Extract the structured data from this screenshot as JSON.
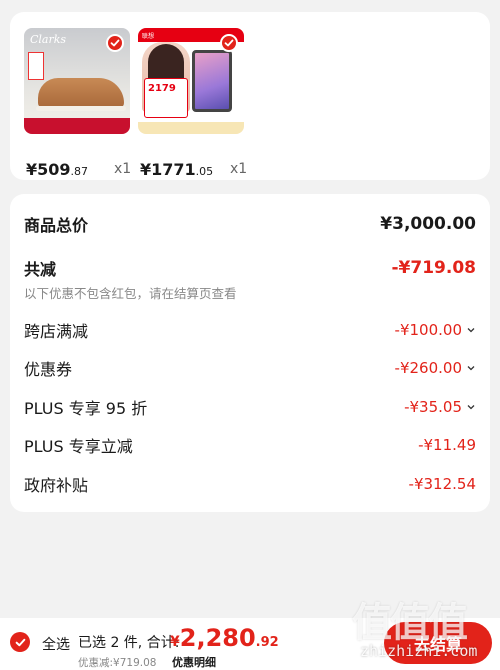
{
  "colors": {
    "accent": "#e2231a",
    "background": "#f2f2f2",
    "card": "#ffffff",
    "muted": "#888888"
  },
  "products": [
    {
      "image_brand": "Clarks",
      "price_symbol": "¥",
      "price_int": "509",
      "price_dec": ".87",
      "qty": "x1",
      "selected_icon": "check-circle-icon"
    },
    {
      "image_brand": "联想",
      "image_price": "2179",
      "price_symbol": "¥",
      "price_int": "1771",
      "price_dec": ".05",
      "qty": "x1",
      "selected_icon": "check-circle-icon"
    }
  ],
  "summary": {
    "total_label": "商品总价",
    "total_value": "¥3,000.00",
    "reduce_label": "共减",
    "reduce_value": "-¥719.08",
    "note": "以下优惠不包含红包，请在结算页查看",
    "items": [
      {
        "label": "跨店满减",
        "value": "-¥100.00",
        "expandable": true
      },
      {
        "label": "优惠券",
        "value": "-¥260.00",
        "expandable": true
      },
      {
        "label": "PLUS 专享 95 折",
        "value": "-¥35.05",
        "expandable": true
      },
      {
        "label": "PLUS 专享立减",
        "value": "-¥11.49",
        "expandable": false
      },
      {
        "label": "政府补贴",
        "value": "-¥312.54",
        "expandable": false
      }
    ]
  },
  "bottom_bar": {
    "select_all": "全选",
    "selected_text": "已选 2 件, 合计:",
    "total_symbol": "¥",
    "total_int": "2,280",
    "total_dec": ".92",
    "discount_text": "优惠减:¥719.08",
    "detail_text": "优惠明细",
    "checkout_label": "去结算"
  },
  "watermark": {
    "big": "值值值",
    "url": "zhizhizhi.com"
  }
}
